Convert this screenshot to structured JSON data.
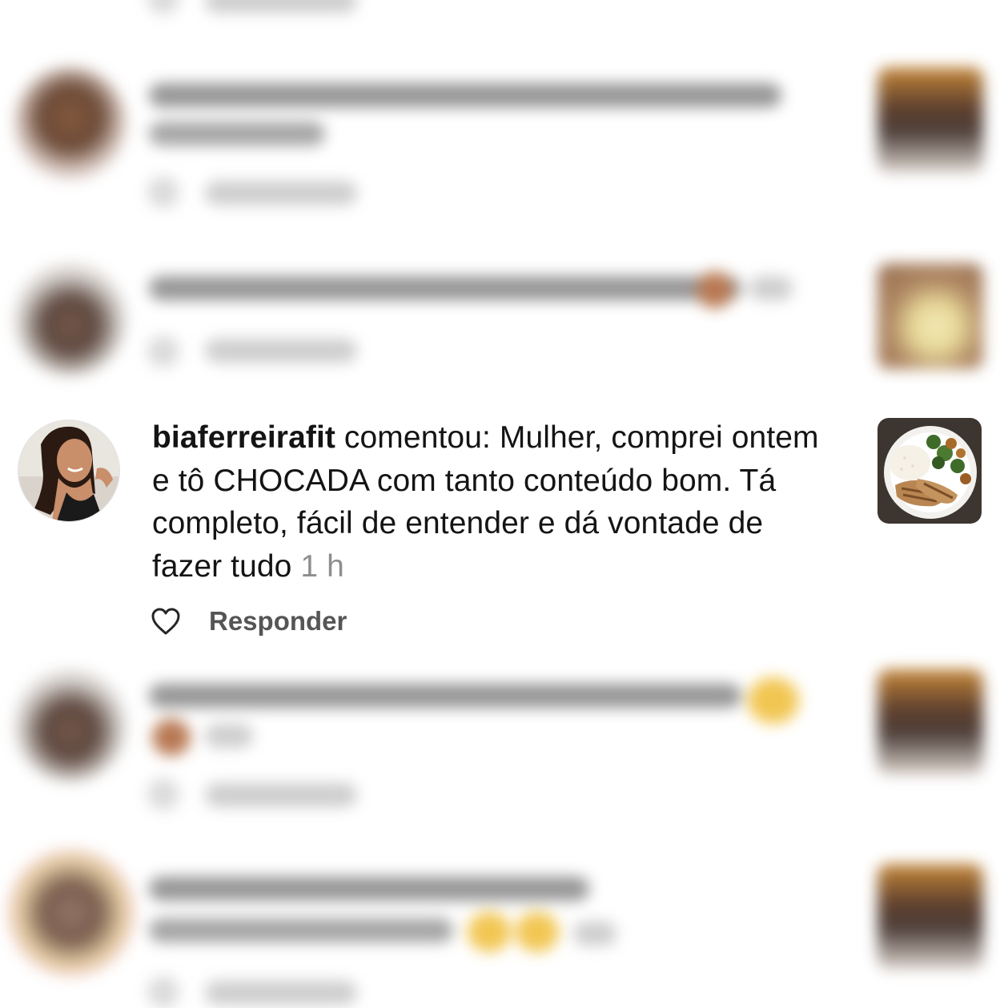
{
  "notifications": {
    "focused": {
      "username": "biaferreirafit",
      "verb": "comentou:",
      "comment": "Mulher, comprei ontem e tô CHOCADA com tanto conteúdo bom. Tá completo, fácil de entender e dá vontade de fazer tudo",
      "time": "1 h",
      "reply_label": "Responder",
      "like_icon": "heart-outline-icon"
    }
  },
  "colors": {
    "text": "#141414",
    "secondary": "#8e8e8e",
    "reply": "#555555",
    "background": "#ffffff"
  }
}
